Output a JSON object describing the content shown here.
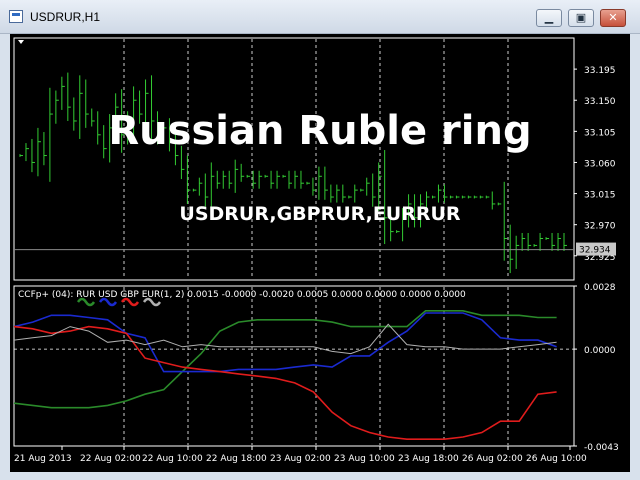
{
  "window": {
    "title": "USDRUR,H1",
    "min_glyph": "▁",
    "restore_glyph": "▣",
    "close_glyph": "✕"
  },
  "overlay": {
    "headline": "Russian Ruble ring",
    "pairs": "USDRUR,GBPRUR,EURRUR"
  },
  "main_chart": {
    "price_labels": [
      "33.195",
      "33.150",
      "33.105",
      "33.060",
      "33.015",
      "32.970",
      "32.925"
    ],
    "current_price": "32.934",
    "colors": {
      "bars": "#33cc33",
      "grid": "#ffffff",
      "axis": "#ffffff",
      "current_line": "#8a8a8a"
    }
  },
  "indicator": {
    "label": "CCFp+ (04): RUR USD GBP EUR(1, 2) 0.0015 -0.0000 -0.0020 0.0005 0.0000 0.0000 0.0000 0.0000",
    "scale_labels": [
      "0.0028",
      "0.0000",
      "-0.0043"
    ],
    "legend": [
      {
        "name": "RUR",
        "color": "#2a8a2a"
      },
      {
        "name": "USD",
        "color": "#1a2ad0"
      },
      {
        "name": "GBP",
        "color": "#e01c1c"
      },
      {
        "name": "EUR",
        "color": "#b0b0b0"
      }
    ]
  },
  "time_axis": [
    "21 Aug 2013",
    "22 Aug 02:00",
    "22 Aug 10:00",
    "22 Aug 18:00",
    "23 Aug 02:00",
    "23 Aug 10:00",
    "23 Aug 18:00",
    "26 Aug 02:00",
    "26 Aug 10:00"
  ],
  "chart_data": {
    "type": "line",
    "title": "Russian Ruble ring",
    "subtitle": "USDRUR,GBPRUR,EURRUR",
    "price_axis": {
      "ylim": [
        32.89,
        33.24
      ],
      "ticks": [
        33.195,
        33.15,
        33.105,
        33.06,
        33.015,
        32.97,
        32.925
      ],
      "current": 32.934
    },
    "bars_close": [
      33.07,
      33.08,
      33.06,
      33.09,
      33.07,
      33.13,
      33.15,
      33.17,
      33.14,
      33.12,
      33.16,
      33.13,
      33.12,
      33.1,
      33.08,
      33.11,
      33.14,
      33.1,
      33.12,
      33.15,
      33.13,
      33.16,
      33.12,
      33.1,
      33.11,
      33.09,
      33.07,
      33.05,
      33.02,
      33.02,
      33.03,
      33.01,
      33.04,
      33.03,
      33.04,
      33.03,
      33.05,
      33.04,
      33.04,
      33.03,
      33.04,
      33.04,
      33.03,
      33.04,
      33.04,
      33.03,
      33.04,
      33.03,
      33.03,
      33.02,
      33.04,
      33.02,
      33.01,
      33.02,
      33.01,
      33.01,
      33.02,
      33.02,
      33.03,
      33.01,
      33.04,
      32.98,
      32.96,
      32.96,
      32.98,
      33.0,
      32.98,
      33.0,
      33.01,
      33.01,
      33.02,
      33.01,
      33.01,
      33.01,
      33.01,
      33.01,
      33.01,
      33.01,
      33.01,
      33.0,
      33.0,
      32.95,
      32.92,
      32.94,
      32.95,
      32.94,
      32.94,
      32.95,
      32.95,
      32.94,
      32.95,
      32.94
    ],
    "indicator_axis": {
      "ylim": [
        -0.0043,
        0.0028
      ],
      "zero": 0.0
    },
    "series": [
      {
        "name": "RUR",
        "values": [
          -0.0024,
          -0.0025,
          -0.0026,
          -0.0026,
          -0.0026,
          -0.0025,
          -0.0023,
          -0.002,
          -0.0018,
          -0.001,
          -0.0002,
          0.0008,
          0.0012,
          0.0013,
          0.0013,
          0.0013,
          0.0013,
          0.0012,
          0.001,
          0.001,
          0.001,
          0.001,
          0.0017,
          0.0017,
          0.0017,
          0.0015,
          0.0015,
          0.0015,
          0.0014,
          0.0014
        ]
      },
      {
        "name": "USD",
        "values": [
          0.001,
          0.0012,
          0.0015,
          0.0015,
          0.0014,
          0.0013,
          0.0007,
          0.0005,
          -0.001,
          -0.001,
          -0.001,
          -0.001,
          -0.0009,
          -0.0009,
          -0.0009,
          -0.0008,
          -0.0007,
          -0.0008,
          -0.0003,
          -0.0003,
          0.0003,
          0.0008,
          0.0016,
          0.0016,
          0.0016,
          0.0013,
          0.0005,
          0.0004,
          0.0004,
          0.0001
        ]
      },
      {
        "name": "GBP",
        "values": [
          0.001,
          0.0009,
          0.0007,
          0.0008,
          0.001,
          0.0009,
          0.0007,
          -0.0004,
          -0.0006,
          -0.0008,
          -0.0009,
          -0.001,
          -0.0011,
          -0.0012,
          -0.0013,
          -0.0015,
          -0.0019,
          -0.0028,
          -0.0034,
          -0.0037,
          -0.0039,
          -0.004,
          -0.004,
          -0.004,
          -0.0039,
          -0.0037,
          -0.0032,
          -0.0032,
          -0.002,
          -0.0019
        ]
      },
      {
        "name": "EUR",
        "values": [
          0.0004,
          0.0005,
          0.0006,
          0.001,
          0.0008,
          0.0003,
          0.0004,
          0.0002,
          0.0004,
          0.0001,
          0.0002,
          0.0001,
          0.0001,
          0.0001,
          0.0001,
          0.0001,
          0.0001,
          -0.0001,
          -0.0002,
          0.0001,
          0.0011,
          0.0002,
          0.0001,
          0.0001,
          0.0,
          0.0,
          0.0,
          0.0001,
          0.0002,
          0.0003
        ]
      }
    ]
  }
}
